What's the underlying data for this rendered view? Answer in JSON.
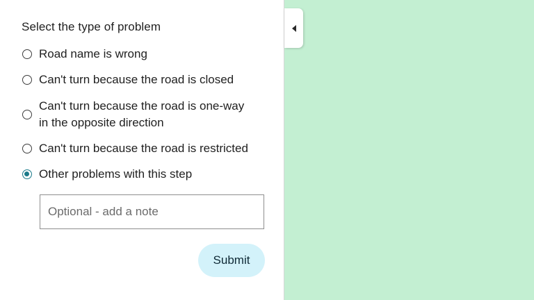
{
  "panel": {
    "heading": "Select the type of problem",
    "options": [
      {
        "label": "Road name is wrong",
        "checked": false
      },
      {
        "label": "Can't turn because the road is closed",
        "checked": false
      },
      {
        "label_line1": "Can't turn because the road is one-way",
        "label_line2": "in the opposite direction",
        "checked": false
      },
      {
        "label": "Can't turn because the road is restricted",
        "checked": false
      },
      {
        "label": "Other problems with this step",
        "checked": true
      }
    ],
    "note": {
      "placeholder": "Optional - add a note",
      "value": ""
    },
    "submit_label": "Submit"
  },
  "collapse": {
    "icon": "caret-left-icon"
  },
  "colors": {
    "map_background": "#c3efd2",
    "accent": "#1a7a8a",
    "submit_background": "#d3f2fa"
  }
}
